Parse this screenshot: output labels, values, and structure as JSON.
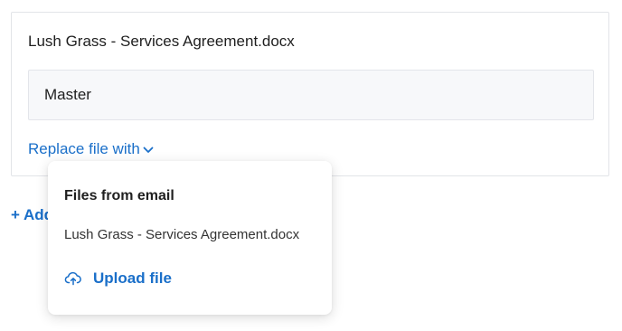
{
  "file_card": {
    "file_name": "Lush Grass - Services Agreement.docx",
    "version_label": "Master",
    "replace_label": "Replace file with"
  },
  "add_link": {
    "label": "+ Add"
  },
  "dropdown": {
    "heading": "Files from email",
    "files": [
      "Lush Grass - Services Agreement.docx"
    ],
    "upload_label": "Upload file"
  },
  "icons": {
    "replace_chevron": "chevron-down-icon",
    "upload": "cloud-upload-icon"
  },
  "colors": {
    "link": "#1a6fc9",
    "text": "#1f1f1f",
    "border": "#e2e4e8",
    "field_bg": "#f7f8fa"
  }
}
